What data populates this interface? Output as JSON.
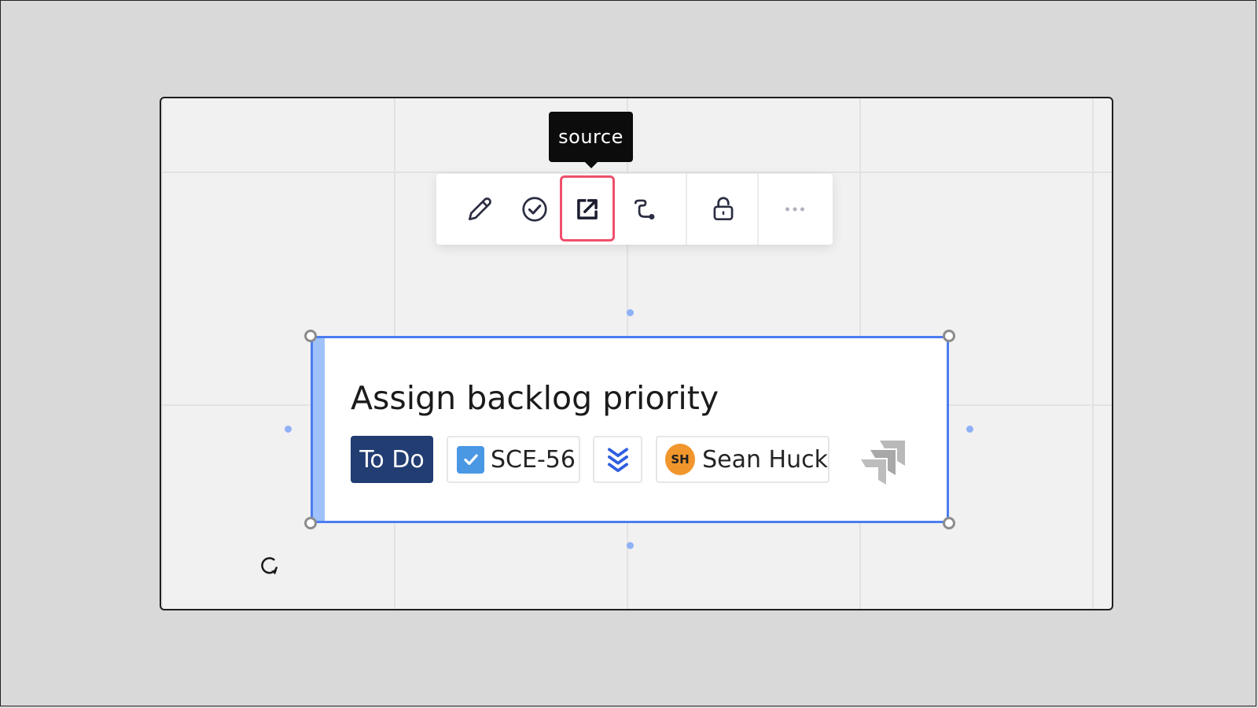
{
  "tooltip": {
    "text": "source"
  },
  "toolbar": {
    "buttons": [
      {
        "icon": "pencil-icon",
        "label": "Edit"
      },
      {
        "icon": "check-circle-icon",
        "label": "Mark done"
      },
      {
        "icon": "open-external-icon",
        "label": "source",
        "active": true
      },
      {
        "icon": "connector-icon",
        "label": "Connect"
      },
      {
        "icon": "unlock-icon",
        "label": "Lock"
      },
      {
        "icon": "more-icon",
        "label": "More"
      }
    ],
    "highlight_color": "#ef4f6b"
  },
  "card": {
    "title": "Assign backlog priority",
    "status": "To Do",
    "issue_key": "SCE-56",
    "priority_icon": "priority-lowest-icon",
    "assignee": {
      "initials": "SH",
      "name": "Sean Huck"
    },
    "accent_color": "#9fc2fb",
    "selection_color": "#4c7df0",
    "status_color": "#213d72",
    "avatar_color": "#f1962c"
  }
}
